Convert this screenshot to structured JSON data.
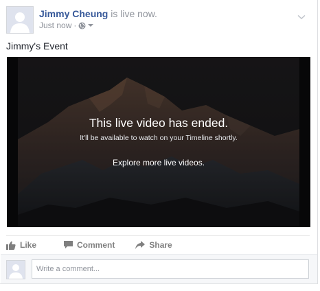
{
  "post": {
    "author_name": "Jimmy Cheung",
    "status_text": "is live now.",
    "timestamp": "Just now",
    "separator": "·",
    "text": "Jimmy's Event",
    "icons": {
      "avatar": "default-avatar-icon",
      "audience": "globe-icon",
      "audience_caret": "caret-down-icon",
      "menu": "chevron-down-icon"
    }
  },
  "video": {
    "title": "This live video has ended.",
    "subtitle": "It'll be available to watch on your Timeline shortly.",
    "link": "Explore more live videos."
  },
  "actions": {
    "like": "Like",
    "comment": "Comment",
    "share": "Share"
  },
  "comment_box": {
    "placeholder": "Write a comment..."
  },
  "colors": {
    "author_link": "#365899",
    "muted_text": "#90949c",
    "action_text": "#7f7f7f"
  }
}
